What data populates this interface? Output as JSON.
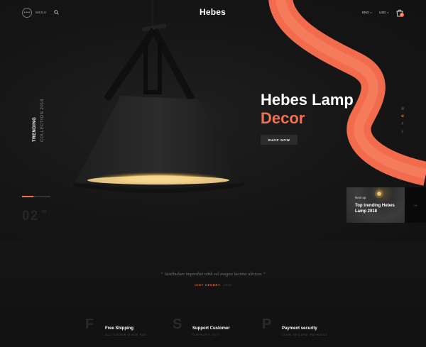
{
  "header": {
    "menu_dots": "• • •",
    "menu_label": "MENU",
    "logo": "Hebes",
    "language": "ENG",
    "currency": "USD",
    "cart_count": "0",
    "caret": "▾"
  },
  "side": {
    "trending": "TRENDING",
    "collection": "COLLECTION 2018"
  },
  "hero": {
    "title_line1": "Hebes Lamp",
    "title_line2": "Decor",
    "button": "SHOP NOW",
    "accent_color": "#f07050"
  },
  "social": [
    "◎",
    "✿",
    "f",
    "t"
  ],
  "slider": {
    "current": "02",
    "total": "/04",
    "arrow": "→"
  },
  "next": {
    "label": "Next up",
    "title": "Top trending Hebes Lamp 2018",
    "arrow": "→"
  },
  "testimonial": {
    "quote": "“ Vestibulum imperdiet nibh vel magna lacinia ultrices ”",
    "name": "IONT HENBRY",
    "role": "CEO"
  },
  "features": [
    {
      "letter": "F",
      "title": "Free Shipping",
      "subtitle": "ALL ORDER OVER $55"
    },
    {
      "letter": "S",
      "title": "Support Customer",
      "subtitle": "SUPPORT 24/7"
    },
    {
      "letter": "P",
      "title": "Payment security",
      "subtitle": "100% SECURE PAYMENT"
    }
  ],
  "icons": {
    "search": "search-icon",
    "cart": "cart-icon",
    "lamp": "pendant-lamp-image"
  }
}
